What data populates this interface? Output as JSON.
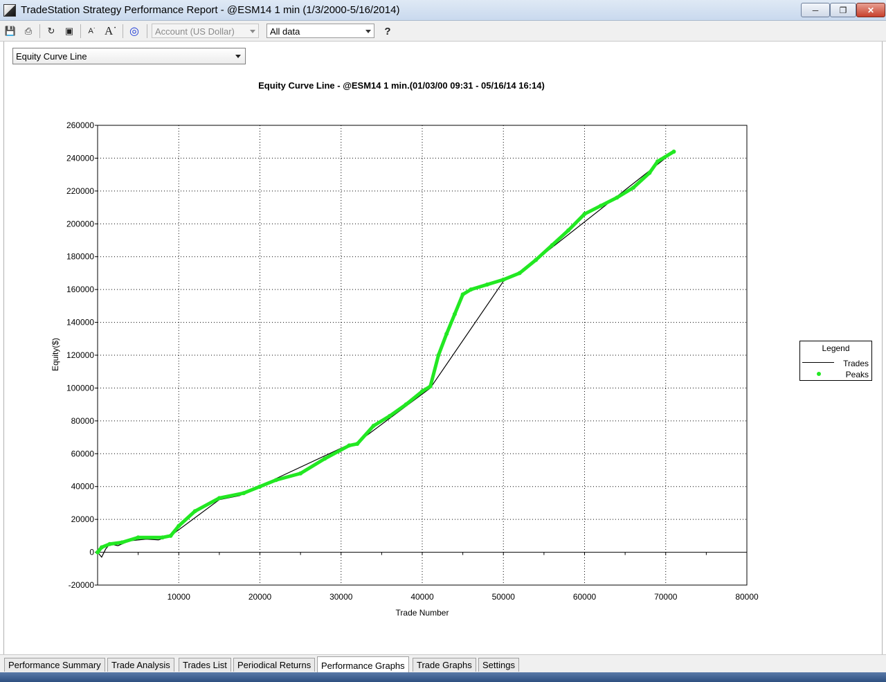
{
  "window": {
    "title": "TradeStation Strategy Performance Report - @ESM14 1 min (1/3/2000-5/16/2014)"
  },
  "toolbar": {
    "account_value": "Account (US Dollar)",
    "range_value": "All data",
    "help_glyph": "?"
  },
  "graph_selector": {
    "selected": "Equity Curve Line"
  },
  "tabs": [
    {
      "label": "Performance Summary"
    },
    {
      "label": "Trade Analysis"
    },
    {
      "label": "Trades List"
    },
    {
      "label": "Periodical Returns"
    },
    {
      "label": "Performance Graphs",
      "active": true
    },
    {
      "label": "Trade Graphs"
    },
    {
      "label": "Settings"
    }
  ],
  "legend": {
    "title": "Legend",
    "items": [
      {
        "name": "Trades"
      },
      {
        "name": "Peaks"
      }
    ]
  },
  "colors": {
    "peaks": "#22e822",
    "trades": "#000000"
  },
  "chart_data": {
    "type": "line",
    "title": "Equity Curve Line - @ESM14 1 min.(01/03/00 09:31 - 05/16/14 16:14)",
    "xlabel": "Trade Number",
    "ylabel": "Equity($)",
    "xlim": [
      0,
      80000
    ],
    "ylim": [
      -20000,
      260000
    ],
    "x_ticks": [
      10000,
      20000,
      30000,
      40000,
      50000,
      60000,
      70000,
      80000
    ],
    "y_ticks": [
      -20000,
      0,
      20000,
      40000,
      60000,
      80000,
      100000,
      120000,
      140000,
      160000,
      180000,
      200000,
      220000,
      240000,
      260000
    ],
    "grid": true,
    "legend_position": "right",
    "series": [
      {
        "name": "Peaks",
        "x": [
          0,
          500,
          1500,
          3000,
          5000,
          8000,
          9000,
          10000,
          12000,
          15000,
          18000,
          20000,
          22000,
          25000,
          28000,
          31000,
          32000,
          34000,
          36000,
          38000,
          40000,
          41000,
          42000,
          43000,
          44000,
          45000,
          46000,
          48000,
          50000,
          52000,
          54000,
          56000,
          58000,
          60000,
          62000,
          64000,
          66000,
          68000,
          69000,
          71000
        ],
        "y": [
          0,
          3000,
          5000,
          6000,
          9000,
          9000,
          10000,
          16000,
          25000,
          33000,
          36000,
          40000,
          44000,
          48000,
          57000,
          65000,
          66000,
          77000,
          83000,
          90000,
          98000,
          101000,
          120000,
          133000,
          145000,
          157000,
          160000,
          163000,
          166000,
          170000,
          178000,
          187000,
          196000,
          206000,
          211000,
          216000,
          222000,
          231000,
          238000,
          244000
        ]
      },
      {
        "name": "Trades",
        "x": [
          0,
          500,
          1000,
          1500,
          2500,
          4000,
          6000,
          7500,
          9000,
          15000,
          17500,
          30500,
          31500,
          41000,
          50000,
          52500,
          71000
        ],
        "y": [
          0,
          -3000,
          2000,
          5000,
          4000,
          7000,
          8000,
          7500,
          10000,
          32000,
          34500,
          64500,
          65000,
          100000,
          165000,
          172000,
          244000
        ]
      }
    ]
  }
}
